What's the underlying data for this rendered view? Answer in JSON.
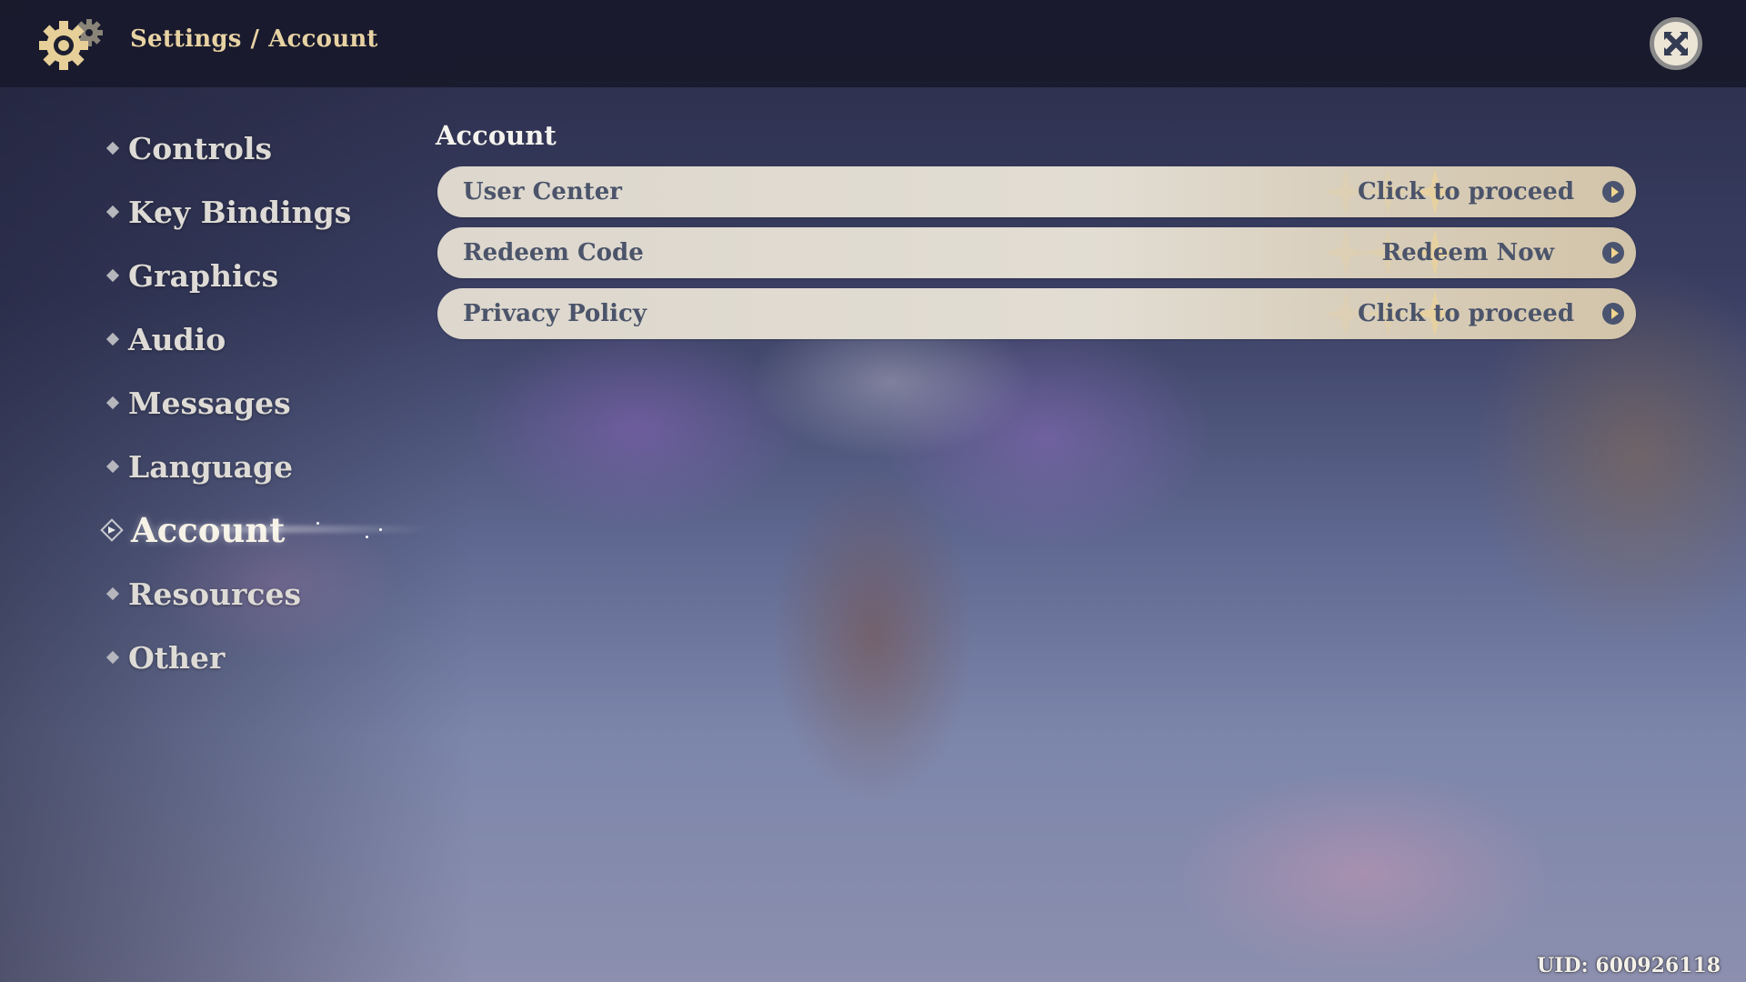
{
  "header": {
    "icon": "gear-icon",
    "breadcrumb": [
      "Settings",
      "Account"
    ],
    "breadcrumb_separator": "/",
    "close_icon": "close-icon"
  },
  "sidebar": {
    "items": [
      {
        "label": "Controls",
        "active": false
      },
      {
        "label": "Key Bindings",
        "active": false
      },
      {
        "label": "Graphics",
        "active": false
      },
      {
        "label": "Audio",
        "active": false
      },
      {
        "label": "Messages",
        "active": false
      },
      {
        "label": "Language",
        "active": false
      },
      {
        "label": "Account",
        "active": true
      },
      {
        "label": "Resources",
        "active": false
      },
      {
        "label": "Other",
        "active": false
      }
    ]
  },
  "main": {
    "section_title": "Account",
    "rows": [
      {
        "label": "User Center",
        "action": "Click to proceed",
        "icon": "arrow-right-circle-icon"
      },
      {
        "label": "Redeem Code",
        "action": "Redeem Now",
        "icon": "arrow-right-circle-icon"
      },
      {
        "label": "Privacy Policy",
        "action": "Click to proceed",
        "icon": "arrow-right-circle-icon"
      }
    ]
  },
  "footer": {
    "uid": "UID: 600926118"
  },
  "colors": {
    "accent_gold": "#e7d2a3",
    "row_text": "#4b546a",
    "row_bg": "#e2ddd3",
    "topbar_bg": "#181a2c"
  }
}
